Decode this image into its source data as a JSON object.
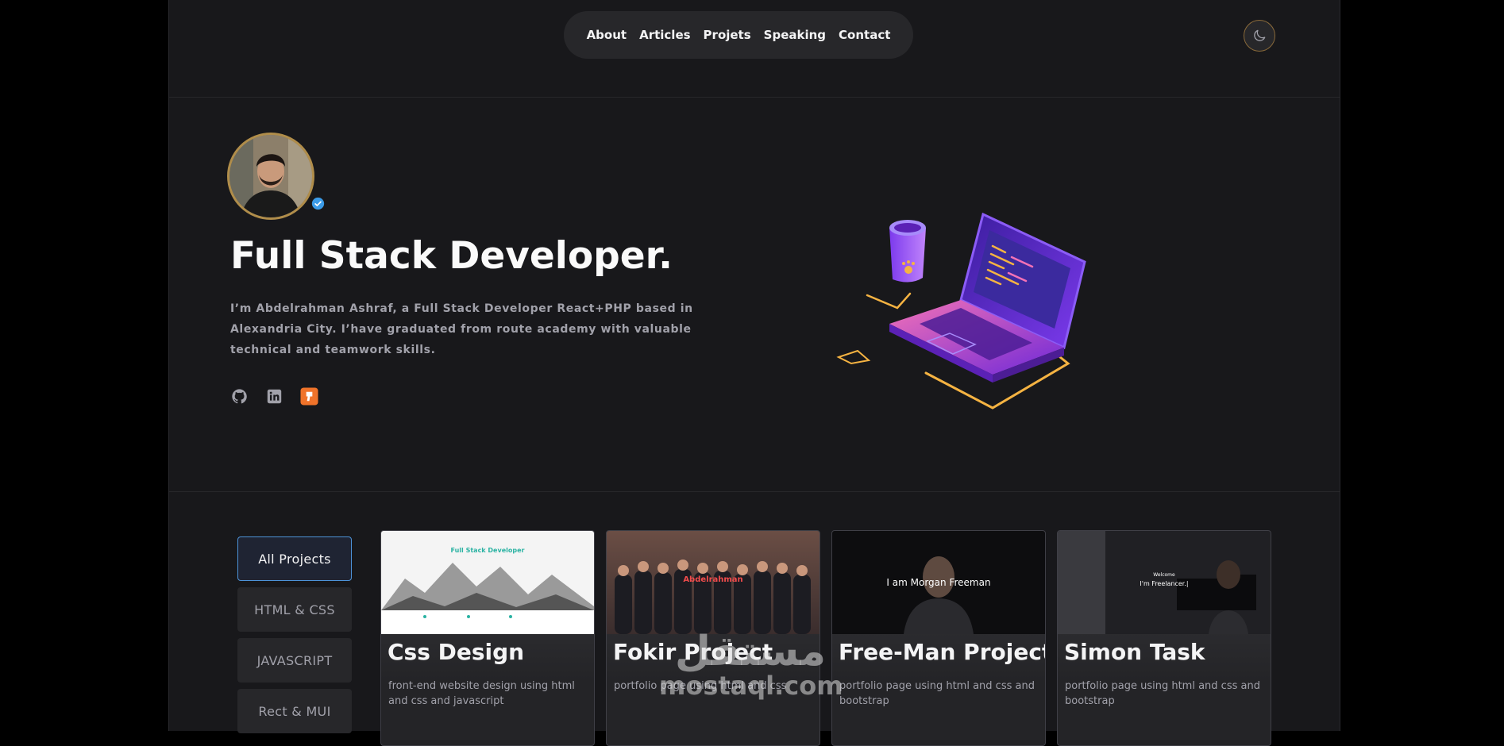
{
  "nav": {
    "items": [
      "About",
      "Articles",
      "Projets",
      "Speaking",
      "Contact"
    ]
  },
  "theme_toggle": {
    "icon": "moon-icon"
  },
  "hero": {
    "title": "Full Stack Developer.",
    "description": "I’m Abdelrahman Ashraf, a Full Stack Developer React+PHP based in Alexandria City. I’have graduated from route academy with valuable technical and teamwork skills.",
    "socials": [
      "github-icon",
      "linkedin-icon",
      "mostaql-icon"
    ]
  },
  "projects": {
    "filters": [
      "All Projects",
      "HTML & CSS",
      "JAVASCRIPT",
      "Rect & MUI"
    ],
    "active_filter": "All Projects",
    "cards": [
      {
        "title": "Css Design",
        "description": "front-end website design using html and css and javascript",
        "thumb_text": "Full Stack Developer"
      },
      {
        "title": "Fokir Project",
        "description": "portfolio page using html and css",
        "thumb_text": "Abdelrahman"
      },
      {
        "title": "Free-Man Project",
        "description": "portfolio page using html and css and bootstrap",
        "thumb_text": "I am Morgan Freeman"
      },
      {
        "title": "Simon Task",
        "description": "portfolio page using html and css and bootstrap",
        "thumb_text": "I'm Freelancer.|"
      }
    ]
  },
  "watermark": {
    "arabic": "مستقل",
    "domain": "mostaql.com"
  },
  "colors": {
    "accent": "#4d93d9",
    "gold": "#b08d4a",
    "purple": "#7c3aed"
  }
}
